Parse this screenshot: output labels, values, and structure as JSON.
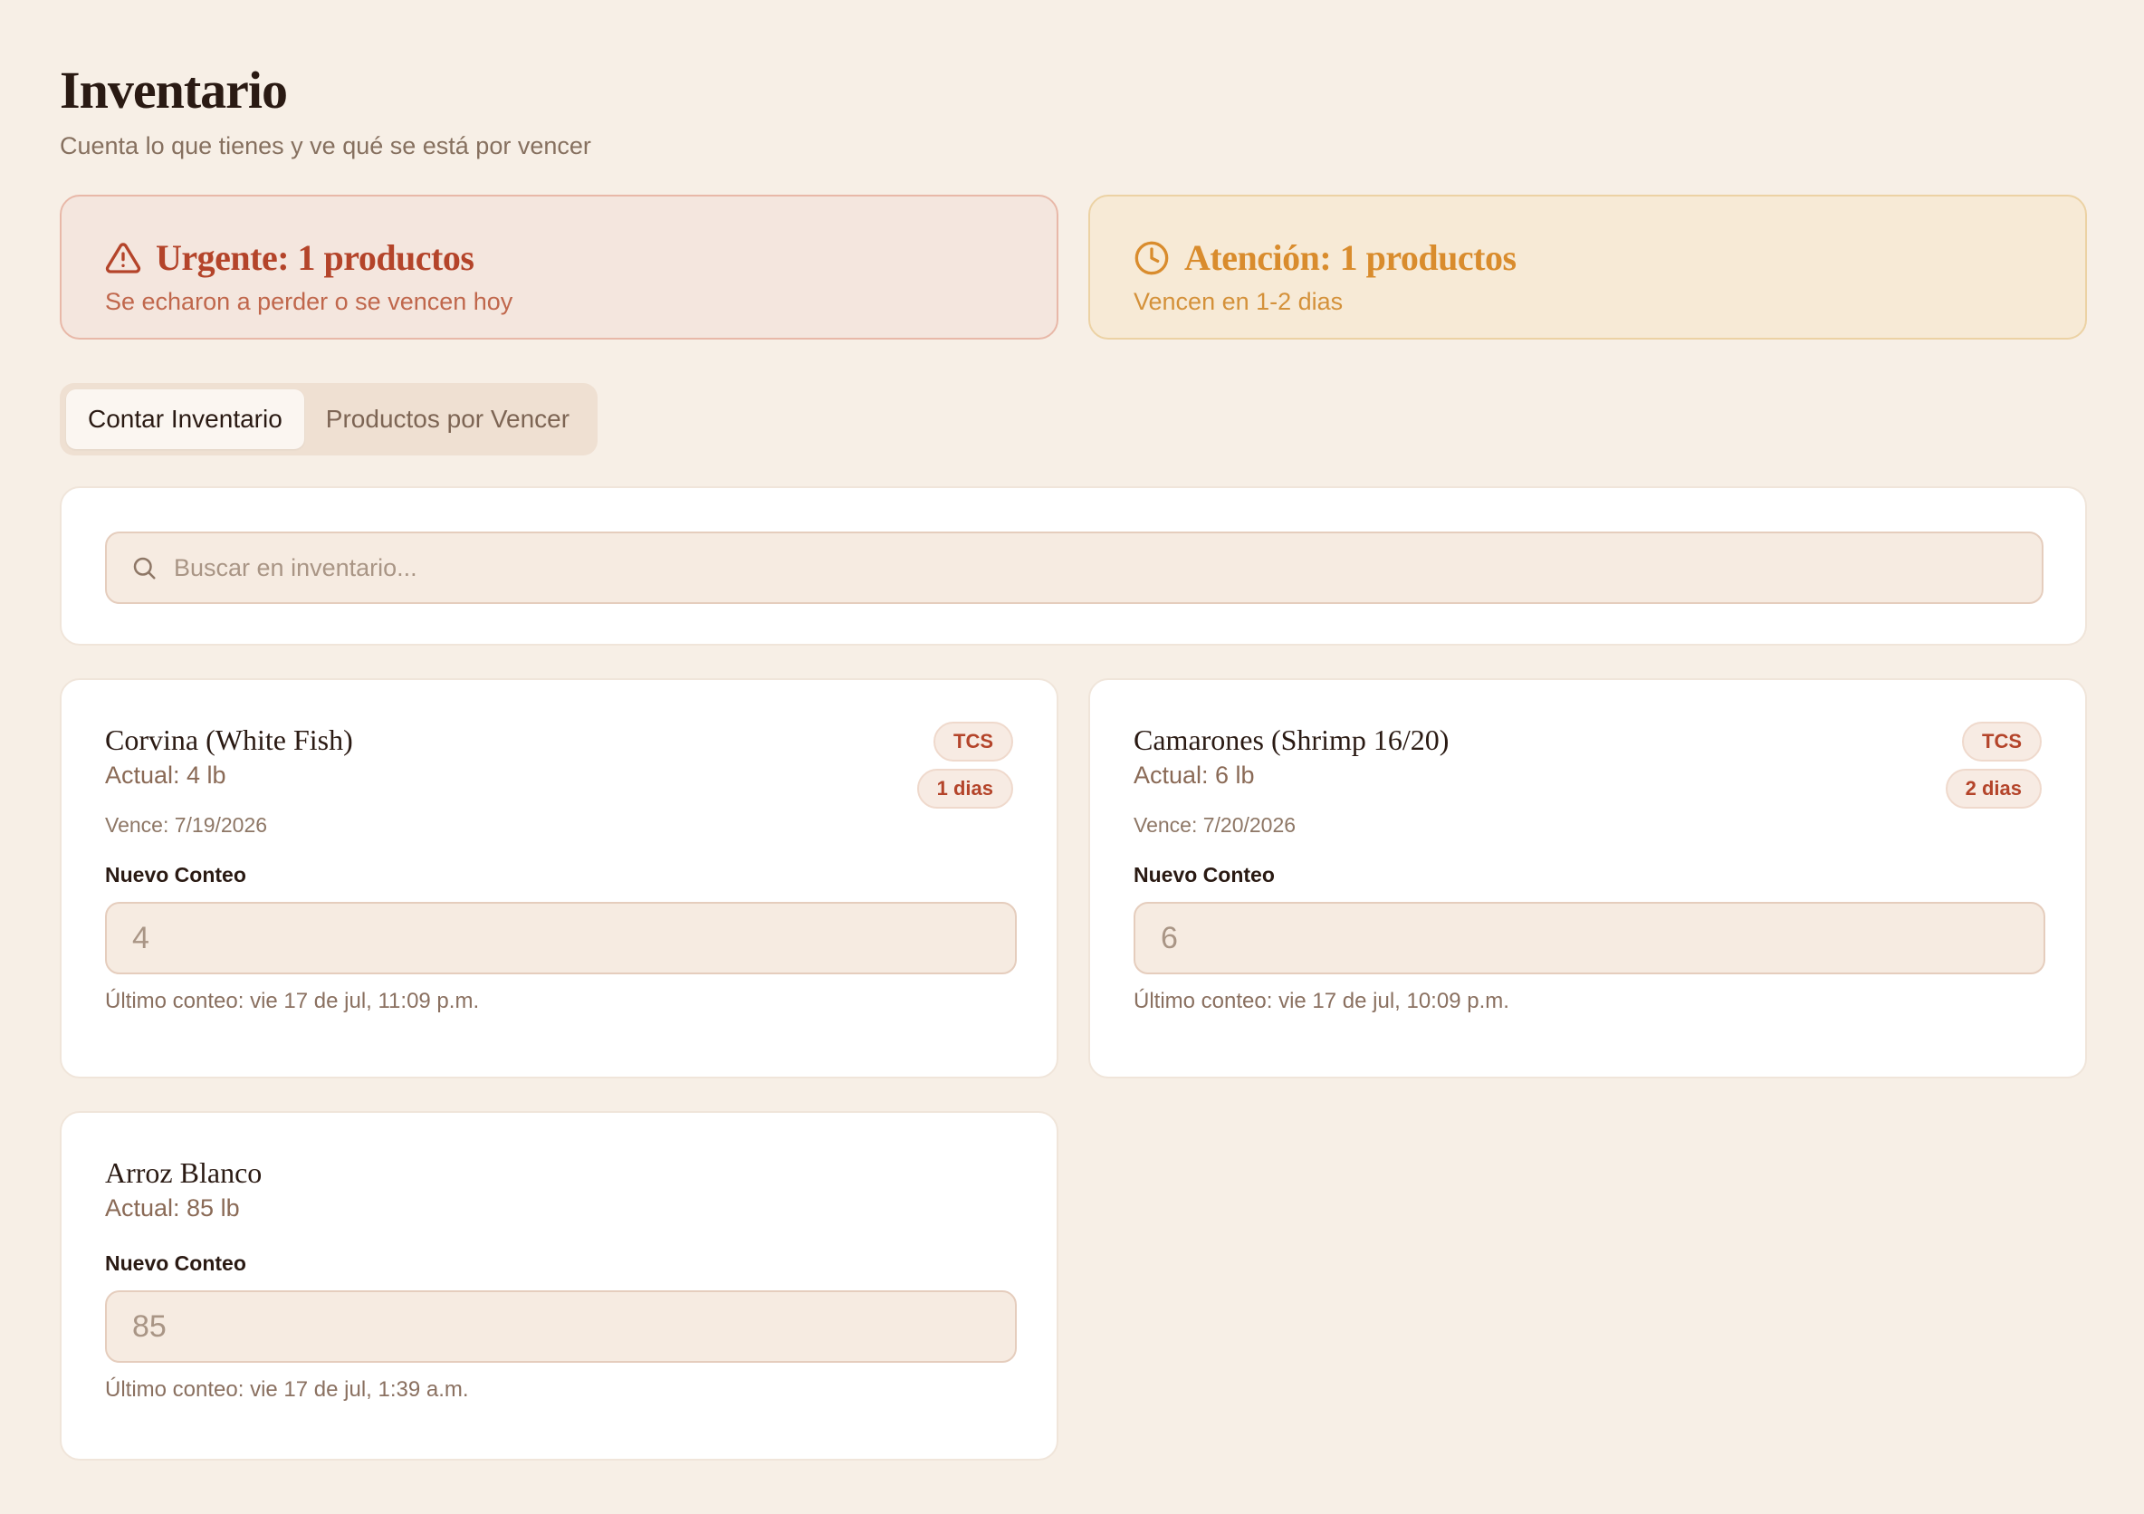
{
  "header": {
    "title": "Inventario",
    "subtitle": "Cuenta lo que tienes y ve qué se está por vencer"
  },
  "alerts": {
    "urgent": {
      "title": "Urgente: 1 productos",
      "description": "Se echaron a perder o se vencen hoy",
      "icon": "warning-triangle-icon",
      "color": "#b4442a"
    },
    "attention": {
      "title": "Atención: 1 productos",
      "description": "Vencen en 1-2 dias",
      "icon": "clock-icon",
      "color": "#d98c2d"
    }
  },
  "tabs": [
    {
      "label": "Contar Inventario",
      "active": true
    },
    {
      "label": "Productos por Vencer",
      "active": false
    }
  ],
  "search": {
    "placeholder": "Buscar en inventario...",
    "value": ""
  },
  "items": [
    {
      "name": "Corvina (White Fish)",
      "actual": "Actual: 4 lb",
      "expiry": "Vence: 7/19/2026",
      "badges": [
        "TCS",
        "1 dias"
      ],
      "count_label": "Nuevo Conteo",
      "count_placeholder": "4",
      "last_count": "Último conteo: vie 17 de jul, 11:09 p.m."
    },
    {
      "name": "Camarones (Shrimp 16/20)",
      "actual": "Actual: 6 lb",
      "expiry": "Vence: 7/20/2026",
      "badges": [
        "TCS",
        "2 dias"
      ],
      "count_label": "Nuevo Conteo",
      "count_placeholder": "6",
      "last_count": "Último conteo: vie 17 de jul, 10:09 p.m."
    },
    {
      "name": "Arroz Blanco",
      "actual": "Actual: 85 lb",
      "count_label": "Nuevo Conteo",
      "count_placeholder": "85",
      "last_count": "Último conteo: vie 17 de jul, 1:39 a.m."
    }
  ]
}
